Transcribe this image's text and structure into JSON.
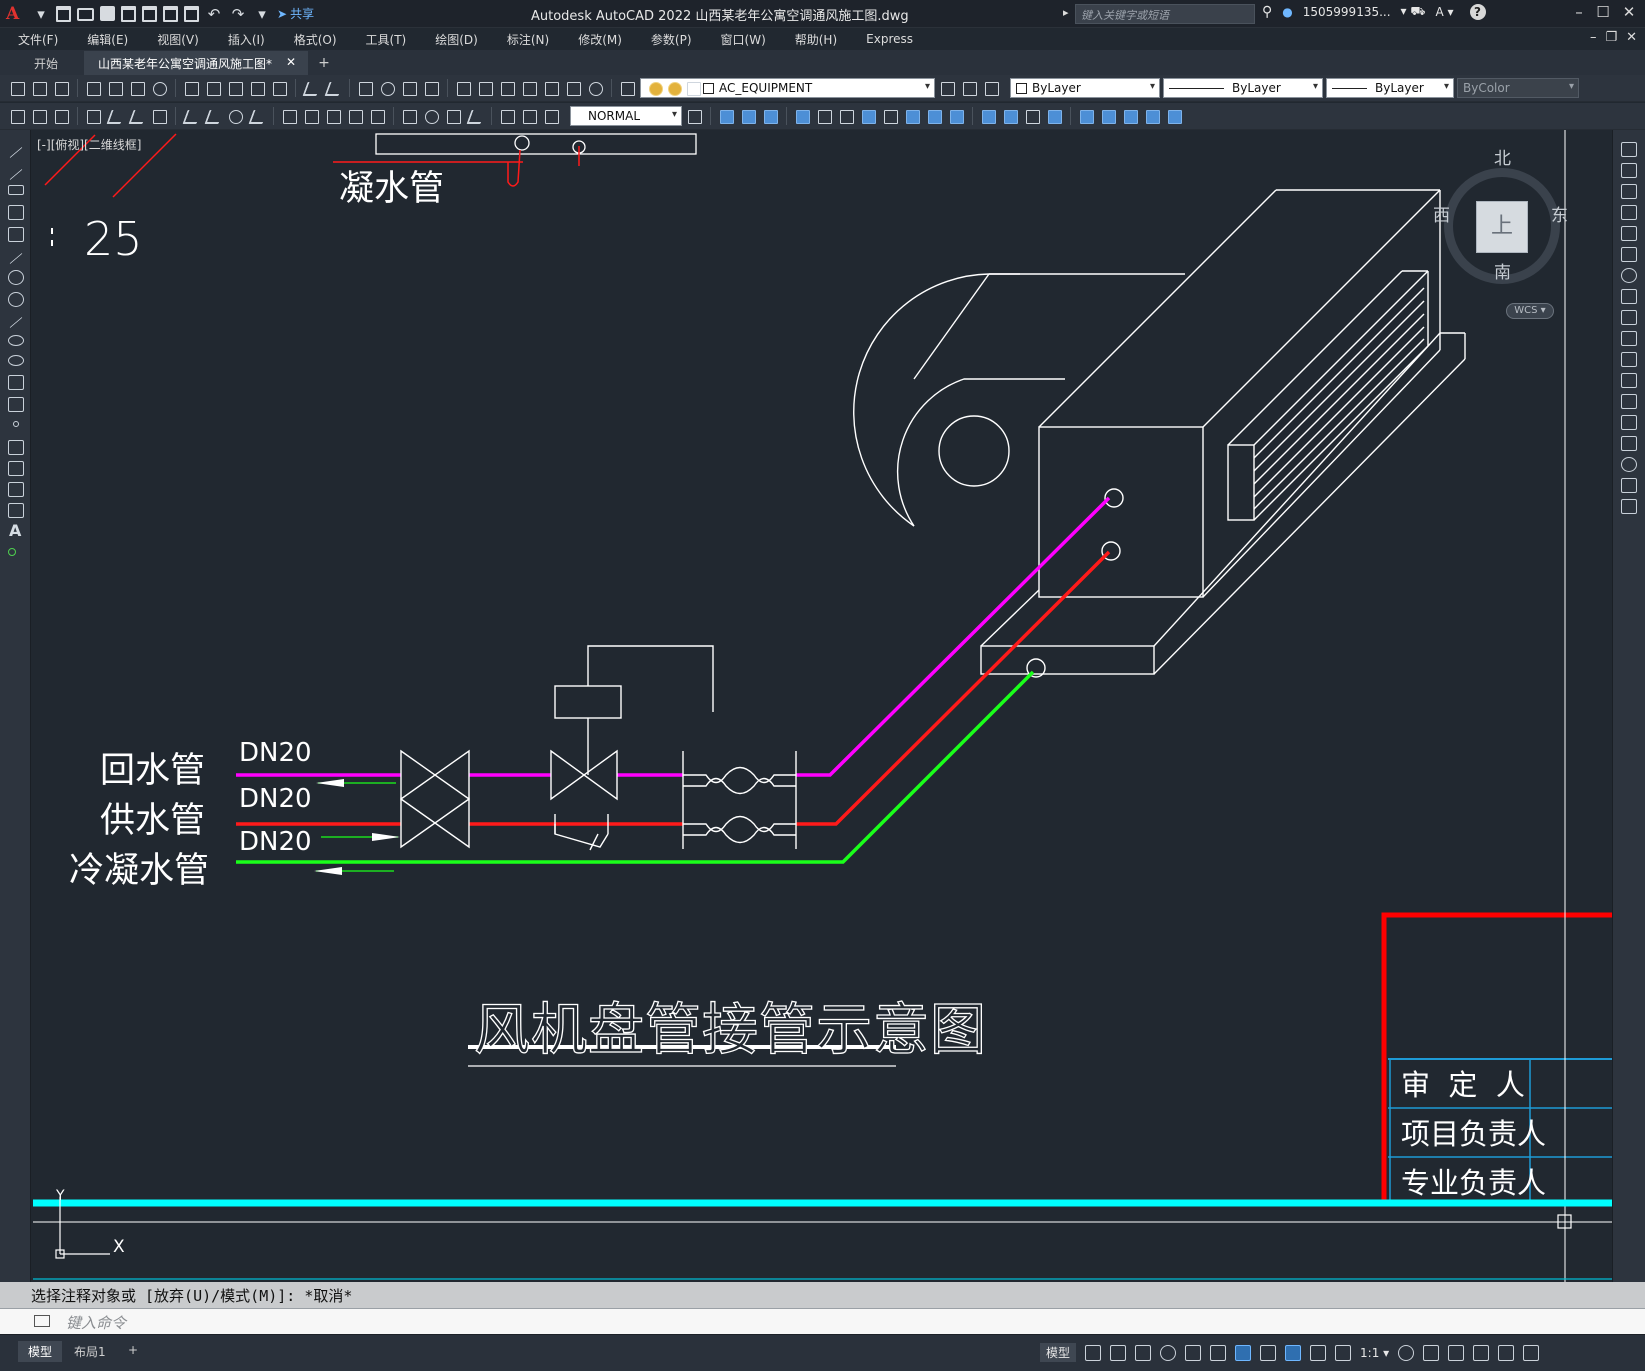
{
  "app": {
    "logo": "A",
    "title": "Autodesk AutoCAD 2022    山西某老年公寓空调通风施工图.dwg",
    "share_label": "共享",
    "search_placeholder": "键入关键字或短语",
    "user": "1505999135...",
    "help": "?"
  },
  "menu": [
    "文件(F)",
    "编辑(E)",
    "视图(V)",
    "插入(I)",
    "格式(O)",
    "工具(T)",
    "绘图(D)",
    "标注(N)",
    "修改(M)",
    "参数(P)",
    "窗口(W)",
    "帮助(H)",
    "Express"
  ],
  "tabs": {
    "start": "开始",
    "active": "山西某老年公寓空调通风施工图*",
    "close": "✕",
    "add": "+"
  },
  "toolbar": {
    "layer": "AC_EQUIPMENT",
    "color": "ByLayer",
    "linetype": "ByLayer",
    "lineweight": "ByLayer",
    "plotstyle": "ByColor",
    "dimstyle": "NORMAL"
  },
  "viewport": {
    "label": "[-][俯视][二维线框]"
  },
  "viewcube": {
    "north": "北",
    "south": "南",
    "east": "东",
    "west": "西",
    "top": "上",
    "wcs": "WCS ▾"
  },
  "drawing": {
    "header_label": "凝水管",
    "number": "25",
    "pipes": [
      {
        "name": "回水管",
        "size": "DN20",
        "color": "#ff00ff"
      },
      {
        "name": "供水管",
        "size": "DN20",
        "color": "#ff1a1a"
      },
      {
        "name": "冷凝水管",
        "size": "DN20",
        "color": "#1aff1a"
      }
    ],
    "title": "风机盘管接管示意图",
    "title_block": [
      "审  定  人",
      "项目负责人",
      "专业负责人"
    ],
    "ucs_y": "Y",
    "ucs_x": "X"
  },
  "command": {
    "history": "选择注释对象或 [放弃(U)/模式(M)]: *取消*",
    "placeholder": "键入命令"
  },
  "layout_tabs": [
    "模型",
    "布局1",
    "+"
  ],
  "status": {
    "model": "模型",
    "scale": "1:1 ▾"
  },
  "colors": {
    "background": "#212830",
    "magenta": "#ff00ff",
    "red": "#ff1a1a",
    "green": "#1aff1a",
    "cyan": "#00ffff",
    "titleblock_red": "#ff0000",
    "titleblock_blue": "#1e9bd6"
  }
}
